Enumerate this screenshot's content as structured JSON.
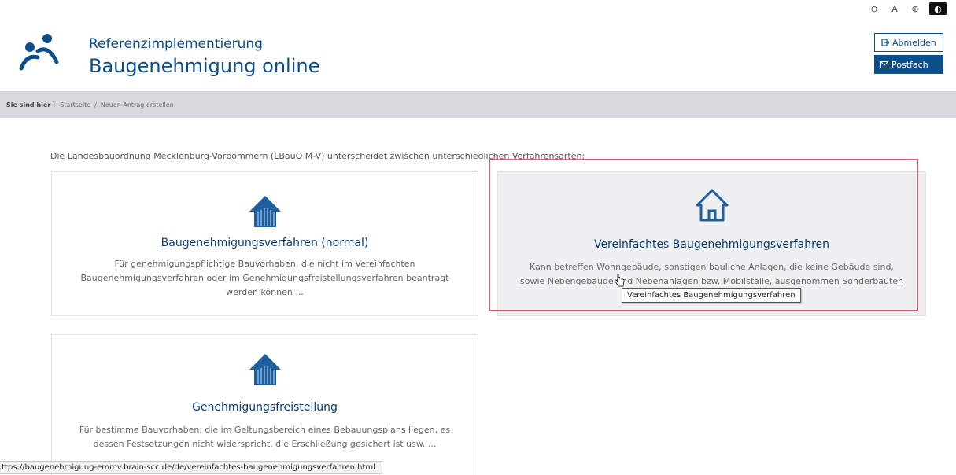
{
  "a11y": {
    "contrast_label": "⊖",
    "font_small_label": "A",
    "font_large_label": "⊕",
    "dark_label": "◐"
  },
  "header": {
    "subtitle": "Referenzimplementierung",
    "title": "Baugenehmigung online",
    "logout_label": "Abmelden",
    "mailbox_label": "Postfach"
  },
  "breadcrumb": {
    "prefix": "Sie sind hier :",
    "items": [
      "Startseite",
      "Neuen Antrag erstellen"
    ],
    "separator": "/"
  },
  "main": {
    "intro": "Die Landesbauordnung Mecklenburg-Vorpommern (LBauO M-V) unterscheidet zwischen unterschiedlichen Verfahrensarten:",
    "cards": [
      {
        "title": "Baugenehmigungsverfahren (normal)",
        "desc": "Für genehmigungspflichtige Bauvorhaben, die nicht im Vereinfachten Baugenehmigungsverfahren oder im Genehmigungsfreistellungsverfahren beantragt werden können ..."
      },
      {
        "title": "Vereinfachtes Baugenehmigungsverfahren",
        "desc": "Kann betreffen Wohngebäude, sonstigen bauliche Anlagen, die keine Gebäude sind, sowie Nebengebäude und Nebenanlagen bzw. Mobilställe, ausgenommen Sonderbauten ..."
      },
      {
        "title": "Genehmigungsfreistellung",
        "desc": "Für bestimme Bauvorhaben, die im Geltungsbereich eines Bebauungsplans liegen, es dessen Festsetzungen nicht widerspricht, die Erschließung gesichert ist usw. ..."
      }
    ]
  },
  "tooltip": "Vereinfachtes Baugenehmigungsverfahren",
  "status_url": "ttps://baugenehmigung-emmv.brain-scc.de/de/vereinfachtes-baugenehmigungsverfahren.html",
  "colors": {
    "brand": "#0b4e8c",
    "title_text": "#0b3d73",
    "breadcrumb_bg": "#d6d9dd",
    "highlight": "#e05a5a"
  },
  "icons": {
    "logo": "people-logo-icon",
    "house_filled": "house-filled-icon",
    "house_outline": "house-outline-icon",
    "logout": "logout-icon",
    "mail": "mail-icon"
  }
}
